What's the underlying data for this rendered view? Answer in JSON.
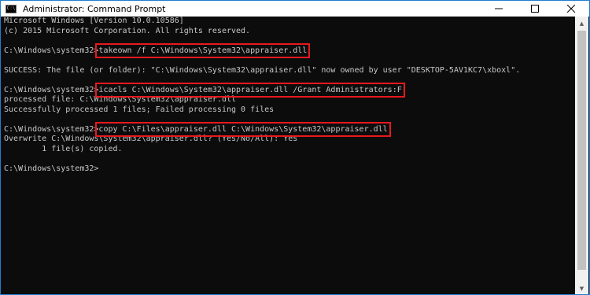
{
  "window": {
    "title": "Administrator: Command Prompt",
    "icon": "cmd-icon",
    "icon_glyph": "C:\\",
    "controls": [
      "minimize-icon",
      "maximize-icon",
      "close-icon"
    ]
  },
  "console": {
    "lines": [
      {
        "prompt": "",
        "text": "Microsoft Windows [Version 10.0.10586]"
      },
      {
        "prompt": "",
        "text": "(c) 2015 Microsoft Corporation. All rights reserved."
      },
      {
        "prompt": "",
        "text": ""
      },
      {
        "prompt": "C:\\Windows\\system32>",
        "text": "takeown /f C:\\Windows\\System32\\appraiser.dll",
        "highlight": true
      },
      {
        "prompt": "",
        "text": ""
      },
      {
        "prompt": "",
        "text": "SUCCESS: The file (or folder): \"C:\\Windows\\System32\\appraiser.dll\" now owned by user \"DESKTOP-5AV1KC7\\xboxl\"."
      },
      {
        "prompt": "",
        "text": ""
      },
      {
        "prompt": "C:\\Windows\\system32>",
        "text": "icacls C:\\Windows\\System32\\appraiser.dll /Grant Administrators:F",
        "highlight": true
      },
      {
        "prompt": "",
        "text": "processed file: C:\\Windows\\System32\\appraiser.dll"
      },
      {
        "prompt": "",
        "text": "Successfully processed 1 files; Failed processing 0 files"
      },
      {
        "prompt": "",
        "text": ""
      },
      {
        "prompt": "C:\\Windows\\system32>",
        "text": "copy C:\\Files\\appraiser.dll C:\\Windows\\System32\\appraiser.dll",
        "highlight": true
      },
      {
        "prompt": "",
        "text": "Overwrite C:\\Windows\\System32\\appraiser.dll? (Yes/No/All): Yes"
      },
      {
        "prompt": "",
        "text": "        1 file(s) copied."
      },
      {
        "prompt": "",
        "text": ""
      },
      {
        "prompt": "C:\\Windows\\system32>",
        "text": ""
      }
    ]
  },
  "colors": {
    "console_bg": "#0c0c0c",
    "console_fg": "#c8c8c8",
    "highlight_box": "#e8181e",
    "window_border": "#1f7fd0"
  }
}
